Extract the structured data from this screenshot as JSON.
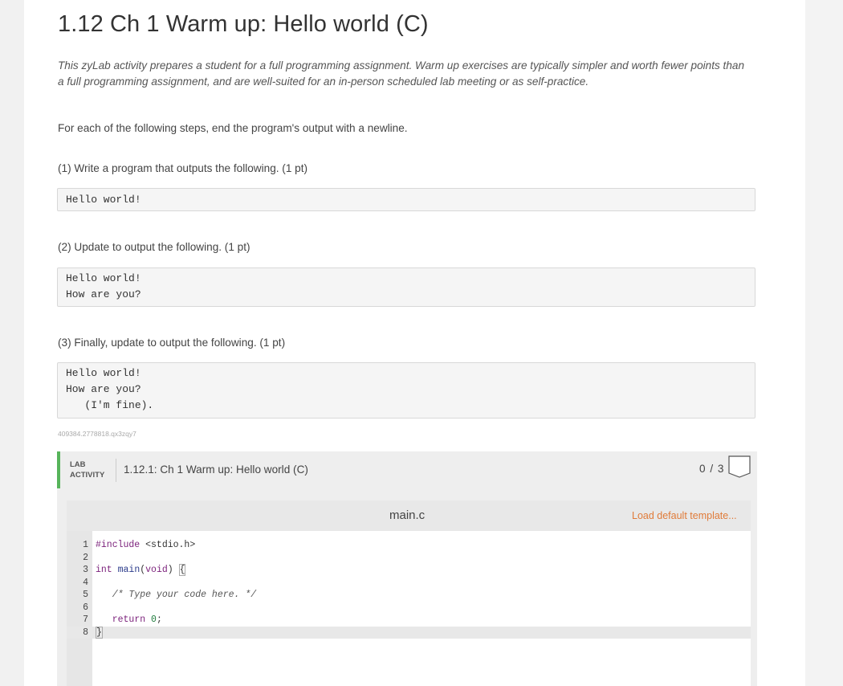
{
  "title": "1.12 Ch 1 Warm up: Hello world (C)",
  "intro": "This zyLab activity prepares a student for a full programming assignment. Warm up exercises are typically simpler and worth fewer points than a full programming assignment, and are well-suited for an in-person scheduled lab meeting or as self-practice.",
  "instructions": "For each of the following steps, end the program's output with a newline.",
  "steps": [
    {
      "label": "(1) Write a program that outputs the following. (1 pt)",
      "output": "Hello world!"
    },
    {
      "label": "(2) Update to output the following. (1 pt)",
      "output": "Hello world!\nHow are you?"
    },
    {
      "label": "(3) Finally, update to output the following. (1 pt)",
      "output": "Hello world!\nHow are you?\n   (I'm fine)."
    }
  ],
  "hash_id": "409384.2778818.qx3zqy7",
  "lab": {
    "label_line1": "LAB",
    "label_line2": "ACTIVITY",
    "title": "1.12.1: Ch 1 Warm up: Hello world (C)",
    "score": "0 / 3"
  },
  "editor": {
    "filename": "main.c",
    "load_template": "Load default template...",
    "lines": [
      {
        "n": "1",
        "code": "#include <stdio.h>"
      },
      {
        "n": "2",
        "code": ""
      },
      {
        "n": "3",
        "code": "int main(void) {"
      },
      {
        "n": "4",
        "code": ""
      },
      {
        "n": "5",
        "code": "   /* Type your code here. */"
      },
      {
        "n": "6",
        "code": ""
      },
      {
        "n": "7",
        "code": "   return 0;"
      },
      {
        "n": "8",
        "code": "}"
      }
    ]
  }
}
